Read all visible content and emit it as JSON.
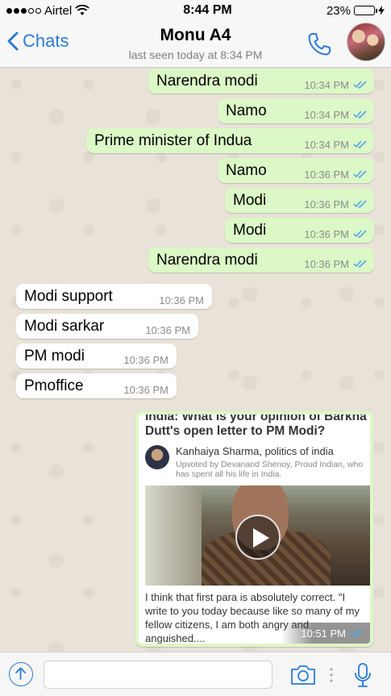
{
  "status_bar": {
    "carrier": "Airtel",
    "time": "8:44 PM",
    "battery_percent": "23%",
    "battery_level": 0.23
  },
  "header": {
    "back_label": "Chats",
    "contact_name": "Monu A4",
    "last_seen": "last seen today at 8:34 PM"
  },
  "messages": [
    {
      "text": "Narendra modi",
      "time": "10:34 PM",
      "direction": "out"
    },
    {
      "text": "Namo",
      "time": "10:34 PM",
      "direction": "out"
    },
    {
      "text": "Prime minister of Indua",
      "time": "10:34 PM",
      "direction": "out"
    },
    {
      "text": "Namo",
      "time": "10:36 PM",
      "direction": "out"
    },
    {
      "text": "Modi",
      "time": "10:36 PM",
      "direction": "out"
    },
    {
      "text": "Modi",
      "time": "10:36 PM",
      "direction": "out"
    },
    {
      "text": "Narendra modi",
      "time": "10:36 PM",
      "direction": "out"
    },
    {
      "text": "Modi support",
      "time": "10:36 PM",
      "direction": "in"
    },
    {
      "text": "Modi sarkar",
      "time": "10:36 PM",
      "direction": "in"
    },
    {
      "text": "PM modi",
      "time": "10:36 PM",
      "direction": "in"
    },
    {
      "text": "Pmoffice",
      "time": "10:36 PM",
      "direction": "in"
    }
  ],
  "shared_card": {
    "headline": "India: What is your opinion of Barkha Dutt's open letter to PM Modi?",
    "author": "Kanhaiya Sharma, politics of india",
    "upvote_line": "Upvoted by Devanand Shenoy, Proud Indian, who has spent all his life in India.",
    "excerpt": "I think that first para is absolutely correct. \"I write to you today because like so many of my fellow citizens, I am both angry and anguished....",
    "time": "10:51 PM"
  },
  "input": {
    "placeholder": ""
  },
  "colors": {
    "accent": "#2a7bd4",
    "outgoing_bubble": "#dcf8c6",
    "incoming_bubble": "#ffffff",
    "read_ticks": "#4fa8e8"
  },
  "icons": [
    "signal-icon",
    "wifi-icon",
    "battery-icon",
    "back-chevron-icon",
    "phone-icon",
    "double-tick-icon",
    "play-icon",
    "upload-icon",
    "camera-icon",
    "mic-icon"
  ]
}
